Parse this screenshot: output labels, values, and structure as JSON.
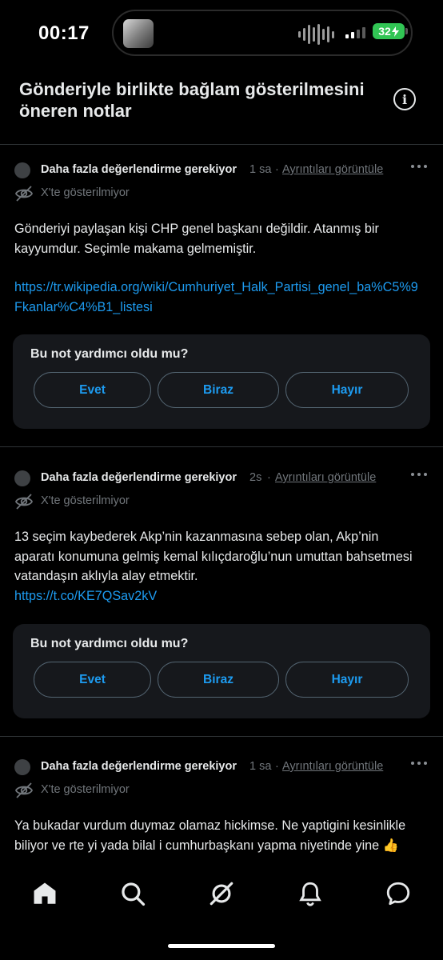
{
  "status_bar": {
    "time": "00:17",
    "battery": "32"
  },
  "header": {
    "title": "Gönderiyle birlikte bağlam gösterilmesini öneren notlar",
    "info_icon": "info-circle-icon"
  },
  "notes": [
    {
      "status": "Daha fazla değerlendirme gerekiyor",
      "time": "1 sa",
      "details_link": "Ayrıntıları görüntüle",
      "visibility": "X'te gösterilmiyor",
      "text": "Gönderiyi paylaşan kişi CHP genel başkanı değildir. Atanmış bir kayyumdur. Seçimle makama gelmemiştir.",
      "link": "https://tr.wikipedia.org/wiki/Cumhuriyet_Halk_Partisi_genel_ba%C5%9Fkanlar%C4%B1_listesi"
    },
    {
      "status": "Daha fazla değerlendirme gerekiyor",
      "time": "2s",
      "details_link": "Ayrıntıları görüntüle",
      "visibility": "X'te gösterilmiyor",
      "text": "13 seçim kaybederek Akp’nin kazanmasına sebep olan, Akp’nin aparatı konumuna gelmiş kemal kılıçdaroğlu’nun umuttan bahsetmesi vatandaşın aklıyla alay etmektir.",
      "link": "https://t.co/KE7QSav2kV"
    },
    {
      "status": "Daha fazla değerlendirme gerekiyor",
      "time": "1 sa",
      "details_link": "Ayrıntıları görüntüle",
      "visibility": "X'te gösterilmiyor",
      "text": "Ya bukadar vurdum duymaz olamaz hickimse. Ne yaptigini kesinlikle biliyor ve rte yi yada bilal i cumhurbaşkanı yapma niyetinde yine 👍"
    }
  ],
  "feedback": {
    "question": "Bu not yardımcı oldu mu?",
    "options": [
      "Evet",
      "Biraz",
      "Hayır"
    ]
  },
  "tabbar": {
    "items": [
      "home-icon",
      "search-icon",
      "grok-icon",
      "notifications-icon",
      "messages-icon"
    ]
  },
  "colors": {
    "background": "#000000",
    "text": "#e7e9ea",
    "muted": "#71767b",
    "link": "#1d9bf0",
    "card": "#16181c",
    "battery": "#31c554"
  }
}
